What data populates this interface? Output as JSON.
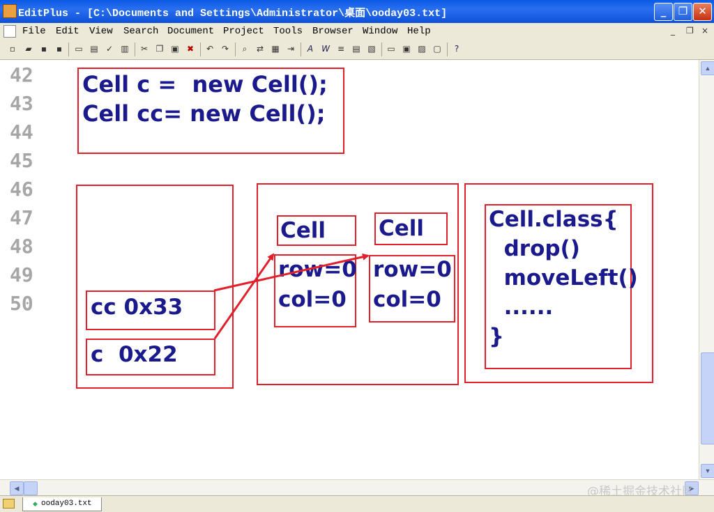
{
  "window": {
    "title": "EditPlus - [C:\\Documents and Settings\\Administrator\\桌面\\ooday03.txt]",
    "minimize_glyph": "_",
    "maximize_glyph": "❐",
    "close_glyph": "✕"
  },
  "menu": {
    "items": [
      {
        "label": "File"
      },
      {
        "label": "Edit"
      },
      {
        "label": "View"
      },
      {
        "label": "Search"
      },
      {
        "label": "Document"
      },
      {
        "label": "Project"
      },
      {
        "label": "Tools"
      },
      {
        "label": "Browser"
      },
      {
        "label": "Window"
      },
      {
        "label": "Help"
      }
    ],
    "mdi_minimize": "_",
    "mdi_restore": "❐",
    "mdi_close": "×"
  },
  "toolbar": {
    "icons": [
      "new-icon",
      "open-icon",
      "save-icon",
      "save-all-icon",
      "print-preview-icon",
      "print-icon",
      "spell-check-icon",
      "browser-icon",
      "cut-icon",
      "copy-icon",
      "paste-icon",
      "delete-icon",
      "undo-icon",
      "redo-icon",
      "find-icon",
      "replace-icon",
      "find-in-files-icon",
      "goto-icon",
      "font-icon",
      "word-wrap-icon",
      "line-number-icon",
      "ruler-icon",
      "column-select-icon",
      "screen-icon",
      "output-icon",
      "directory-icon",
      "cliptext-icon",
      "help-icon"
    ]
  },
  "editor": {
    "line_numbers": [
      "42",
      "43",
      "44",
      "45",
      "46",
      "47",
      "48",
      "49",
      "50"
    ],
    "declaration_lines": [
      "Cell c =  new Cell();",
      "Cell cc= new Cell();"
    ],
    "stack_vars": {
      "cc": "cc 0x33",
      "c": "c  0x22"
    },
    "heap_objects": [
      {
        "class_label": "Cell",
        "fields": [
          "row=0",
          "col=0"
        ]
      },
      {
        "class_label": "Cell",
        "fields": [
          "row=0",
          "col=0"
        ]
      }
    ],
    "method_area": [
      "Cell.class{",
      "  drop()",
      "  moveLeft()",
      "  ......",
      "}"
    ]
  },
  "statusbar": {
    "tab_label": "ooday03.txt",
    "watermark": "@稀土掘金技术社区"
  },
  "colors": {
    "box_border": "#e0202a",
    "code_text": "#1a1a8c",
    "line_numbers": "#a6a6a6",
    "arrow": "#e0202a",
    "title_bar": "#0a5ae6"
  }
}
